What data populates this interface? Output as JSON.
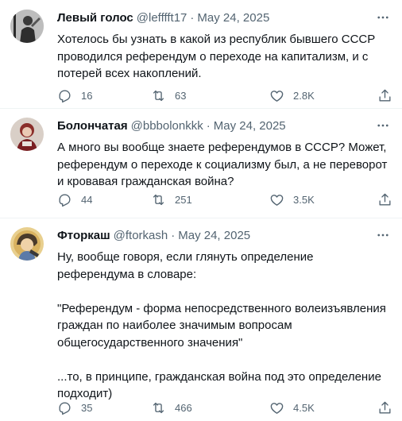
{
  "tweets": [
    {
      "name": "Левый голос",
      "handle": "@lefffft17",
      "sep": "·",
      "date": "May 24, 2025",
      "text": "Хотелось бы узнать в какой из республик бывшего СССР проводился референдум о переходе на капитализм, и с потерей всех накоплений.",
      "replies": "16",
      "retweets": "63",
      "likes": "2.8K"
    },
    {
      "name": "Болончатая",
      "handle": "@bbbolonkkk",
      "sep": "·",
      "date": "May 24, 2025",
      "text": "А много вы вообще знаете референдумов в СССР? Может, референдум о переходе к социализму был, а не переворот и кровавая гражданская война?",
      "replies": "44",
      "retweets": "251",
      "likes": "3.5K"
    },
    {
      "name": "Фторкаш",
      "handle": "@ftorkash",
      "sep": "·",
      "date": "May 24, 2025",
      "text": "Ну, вообще говоря, если глянуть определение референдума в словаре:\n\n\"Референдум - форма непосредственного волеизъявления граждан по наиболее значимым вопросам общегосударственного значения\"\n\n...то, в принципе, гражданская война под это определение подходит)",
      "replies": "35",
      "retweets": "466",
      "likes": "4.5K"
    }
  ],
  "colors": {
    "text": "#0f1419",
    "secondary": "#536471",
    "divider": "#eff3f4"
  },
  "icons": [
    "more-icon",
    "reply-icon",
    "retweet-icon",
    "like-icon",
    "share-icon"
  ]
}
